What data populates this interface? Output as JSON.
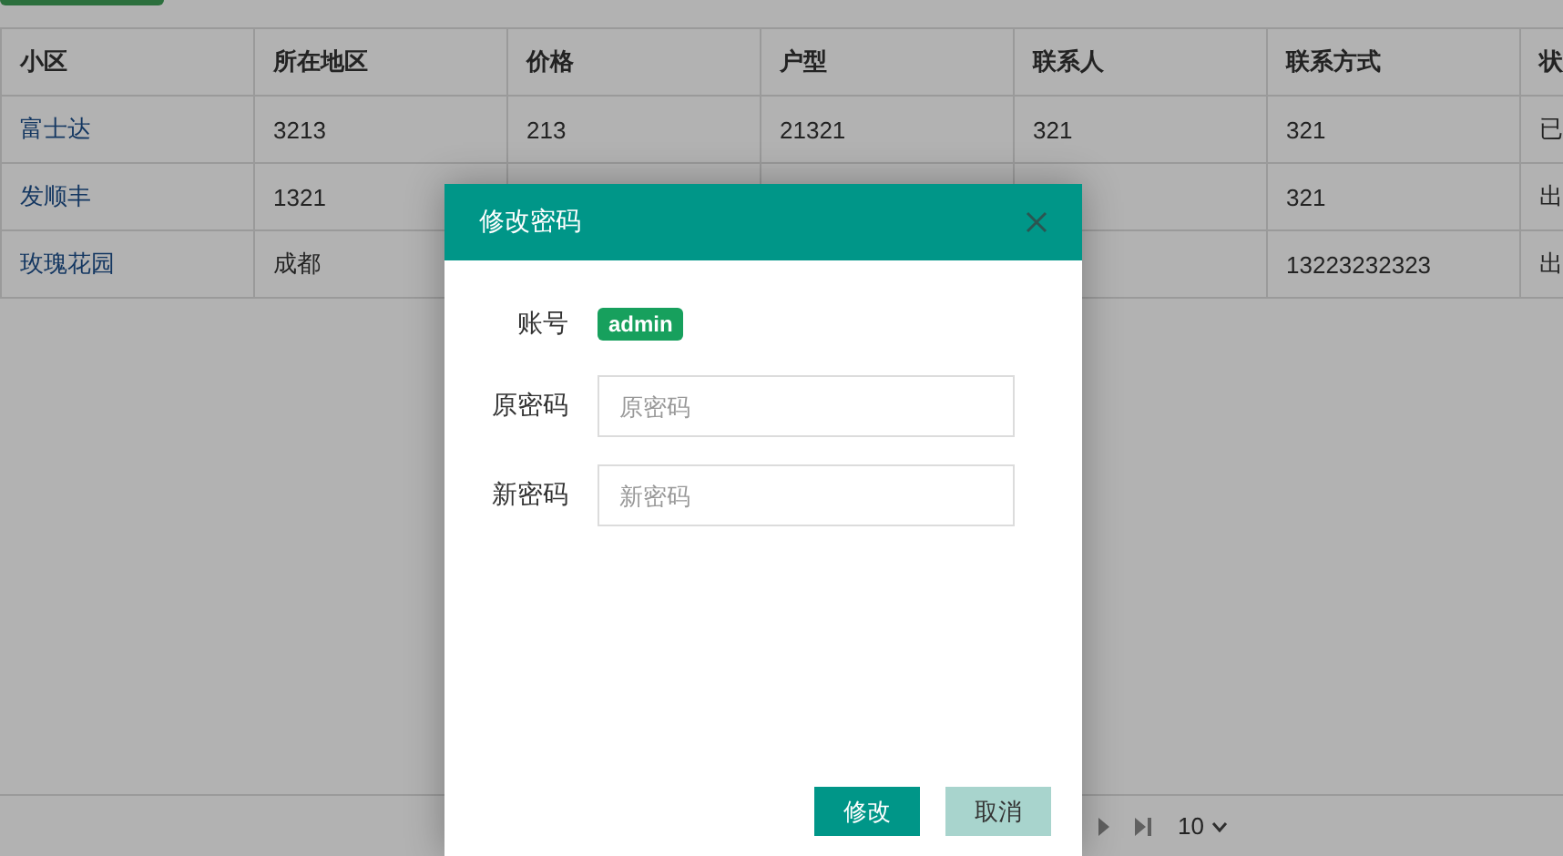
{
  "table": {
    "columns": [
      "小区",
      "所在地区",
      "价格",
      "户型",
      "联系人",
      "联系方式",
      "状"
    ],
    "rows": [
      {
        "cells": [
          "富士达",
          "3213",
          "213",
          "21321",
          "321",
          "321",
          "已"
        ]
      },
      {
        "cells": [
          "发顺丰",
          "1321",
          null,
          null,
          null,
          "321",
          "出"
        ]
      },
      {
        "cells": [
          "玫瑰花园",
          "成都",
          null,
          null,
          null,
          "13223232323",
          "出"
        ]
      }
    ]
  },
  "pager": {
    "page_size": "10"
  },
  "dialog": {
    "title": "修改密码",
    "fields": [
      {
        "kind": "badge",
        "label": "账号",
        "value": "admin"
      },
      {
        "kind": "input",
        "label": "原密码",
        "placeholder": "原密码"
      },
      {
        "kind": "input",
        "label": "新密码",
        "placeholder": "新密码"
      }
    ],
    "buttons": [
      {
        "kind": "primary",
        "label": "修改"
      },
      {
        "kind": "secondary",
        "label": "取消"
      }
    ]
  }
}
